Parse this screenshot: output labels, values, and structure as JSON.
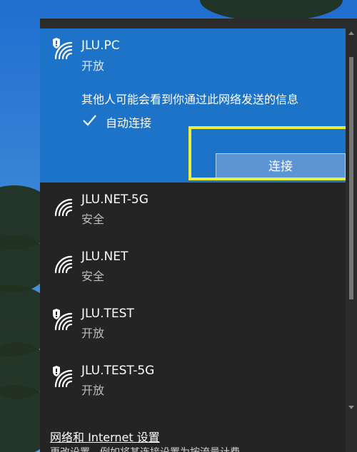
{
  "selected_network": {
    "name": "JLU.PC",
    "status": "开放",
    "warning": "其他人可能会看到你通过此网络发送的信息",
    "auto_connect_label": "自动连接",
    "auto_connect_checked": true,
    "connect_label": "连接",
    "icon": "wifi-shield-icon"
  },
  "networks": [
    {
      "name": "JLU.NET-5G",
      "status": "安全",
      "icon": "wifi-icon"
    },
    {
      "name": "JLU.NET",
      "status": "安全",
      "icon": "wifi-icon"
    },
    {
      "name": "JLU.TEST",
      "status": "开放",
      "icon": "wifi-shield-icon"
    },
    {
      "name": "JLU.TEST-5G",
      "status": "开放",
      "icon": "wifi-shield-icon"
    }
  ],
  "footer": {
    "settings_link": "网络和 Internet 设置",
    "description": "更改设置，例如将某连接设置为按流量计费。"
  },
  "colors": {
    "selected_bg": "#1c73c8",
    "panel_bg": "#242424",
    "highlight": "#e8f03a"
  }
}
